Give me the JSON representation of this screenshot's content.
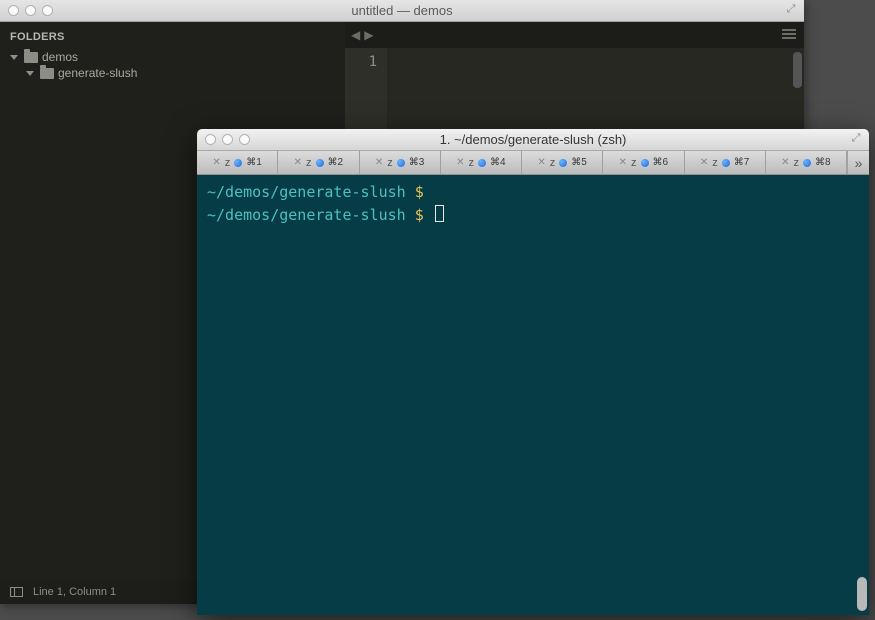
{
  "editor": {
    "title": "untitled — demos",
    "sidebar_header": "FOLDERS",
    "tree": [
      {
        "level": 0,
        "name": "demos"
      },
      {
        "level": 1,
        "name": "generate-slush"
      }
    ],
    "line_number": "1",
    "status": "Line 1, Column 1"
  },
  "terminal": {
    "title": "1. ~/demos/generate-slush (zsh)",
    "tabs": [
      {
        "label": "z",
        "shortcut": "⌘1"
      },
      {
        "label": "z",
        "shortcut": "⌘2"
      },
      {
        "label": "z",
        "shortcut": "⌘3"
      },
      {
        "label": "z",
        "shortcut": "⌘4"
      },
      {
        "label": "z",
        "shortcut": "⌘5"
      },
      {
        "label": "z",
        "shortcut": "⌘6"
      },
      {
        "label": "z",
        "shortcut": "⌘7"
      },
      {
        "label": "z",
        "shortcut": "⌘8"
      }
    ],
    "overflow_glyph": "»",
    "prompt_path": "~/demos/generate-slush",
    "prompt_symbol": "$",
    "lines": [
      {
        "path": "~/demos/generate-slush",
        "symbol": "$",
        "cursor": false
      },
      {
        "path": "~/demos/generate-slush",
        "symbol": "$",
        "cursor": true
      }
    ]
  }
}
